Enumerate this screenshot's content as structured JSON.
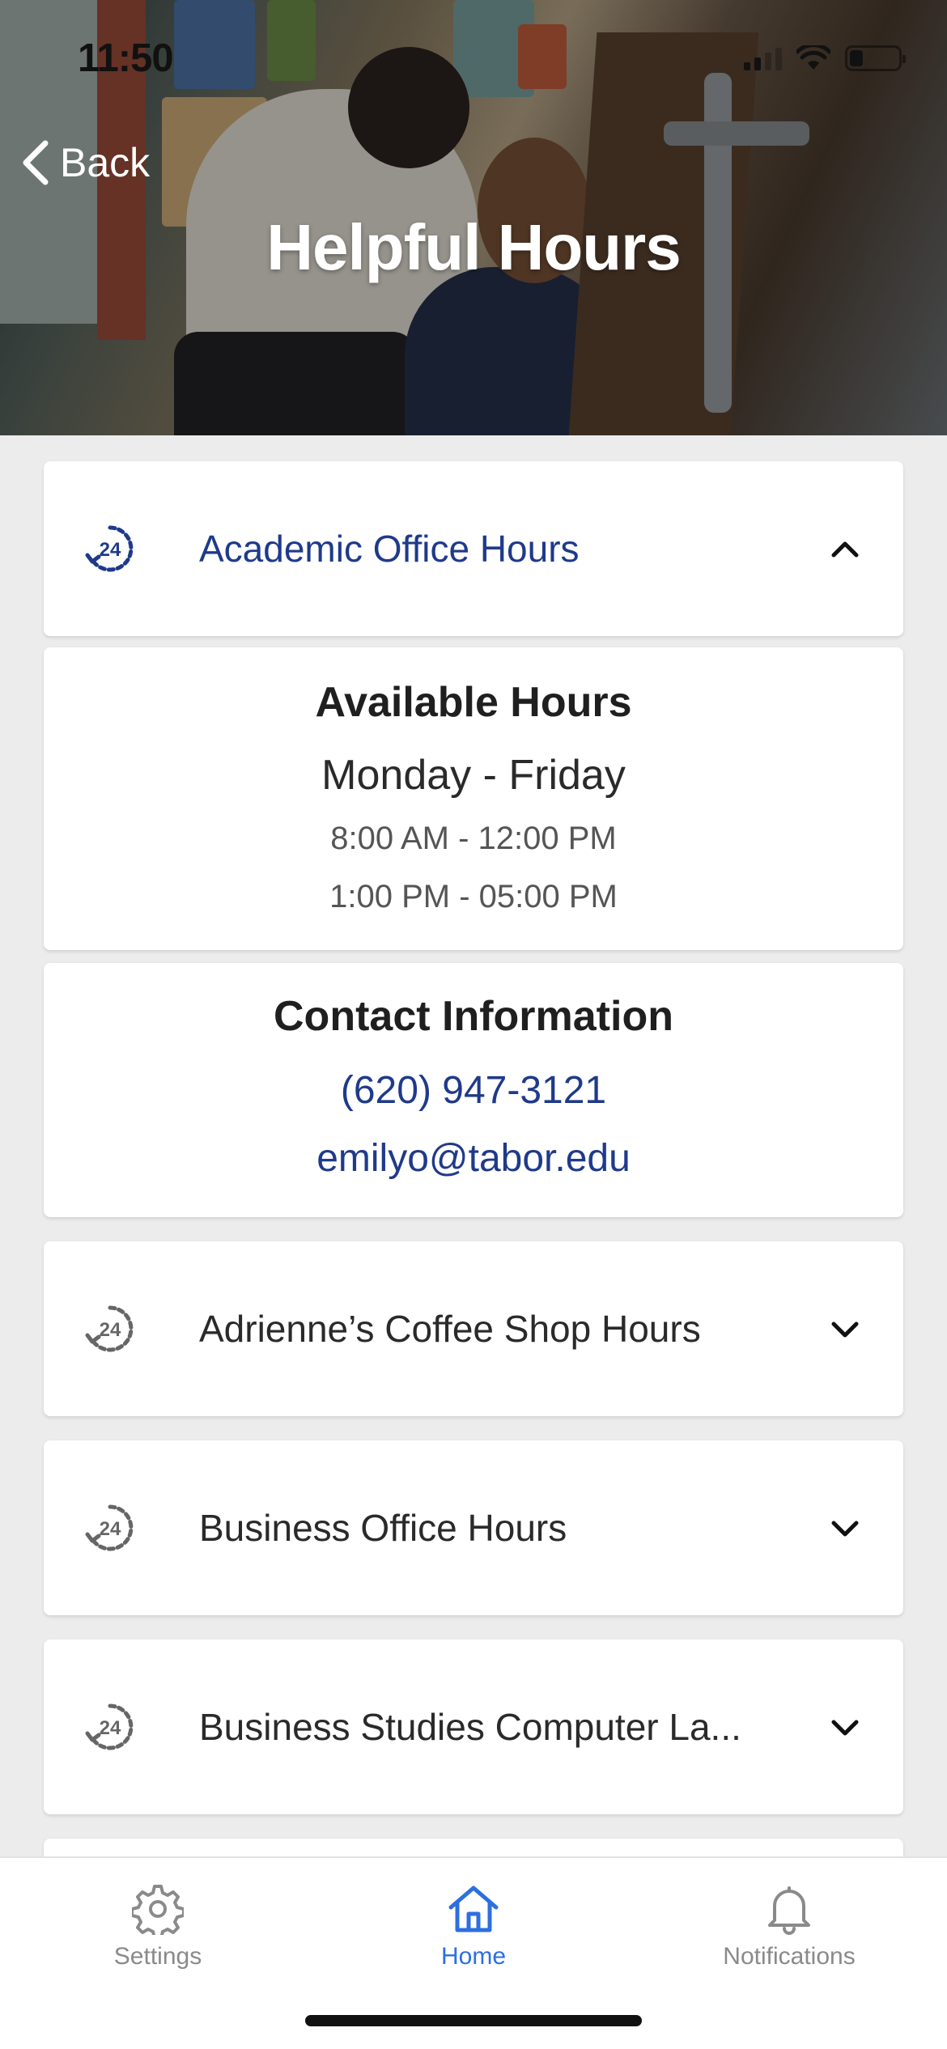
{
  "status_bar": {
    "time": "11:50"
  },
  "header": {
    "back_label": "Back",
    "title": "Helpful Hours"
  },
  "accordion": {
    "expanded": {
      "label": "Academic Office Hours",
      "icon": "clock-24-icon",
      "chevron": "chevron-up-icon"
    },
    "available_hours": {
      "title": "Available Hours",
      "days": "Monday - Friday",
      "slots": [
        "8:00 AM - 12:00 PM",
        "1:00 PM - 05:00 PM"
      ]
    },
    "contact": {
      "title": "Contact Information",
      "phone": "(620) 947-3121",
      "email": "emilyo@tabor.edu"
    },
    "collapsed_items": [
      {
        "label": "Adrienne’s Coffee Shop Hours",
        "icon": "clock-24-icon",
        "chevron": "chevron-down-icon"
      },
      {
        "label": "Business Office Hours",
        "icon": "clock-24-icon",
        "chevron": "chevron-down-icon"
      },
      {
        "label": "Business Studies Computer La...",
        "icon": "clock-24-icon",
        "chevron": "chevron-down-icon"
      }
    ]
  },
  "tab_bar": {
    "items": [
      {
        "label": "Settings",
        "icon": "gear-icon",
        "active": false
      },
      {
        "label": "Home",
        "icon": "home-icon",
        "active": true
      },
      {
        "label": "Notifications",
        "icon": "bell-icon",
        "active": false
      }
    ]
  },
  "colors": {
    "accent_blue": "#1f3a8a",
    "tab_active": "#2c6fe0",
    "background": "#ececec"
  }
}
